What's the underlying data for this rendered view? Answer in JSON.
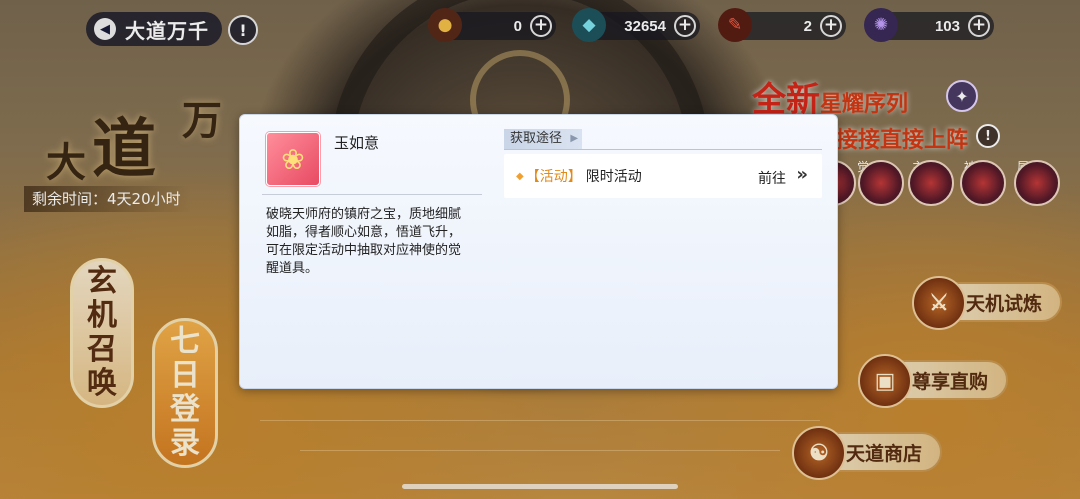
{
  "header": {
    "back_title": "大道万千",
    "info_glyph": "!",
    "resources": [
      {
        "icon": "coin-icon",
        "value": "0",
        "color": "#e0503c"
      },
      {
        "icon": "jade-icon",
        "value": "32654",
        "color": "#3fb6c8"
      },
      {
        "icon": "ticket-icon",
        "value": "2",
        "color": "#e04a2a"
      },
      {
        "icon": "orb-icon",
        "value": "103",
        "color": "#9a6ad8"
      }
    ],
    "plus_glyph": "+"
  },
  "banner": {
    "title_chars": [
      "大",
      "道",
      "万"
    ],
    "timer": "剩余时间：4天20小时",
    "xuanji": [
      "玄",
      "机",
      "召",
      "唤"
    ],
    "qiri": [
      "七",
      "日",
      "登",
      "录"
    ]
  },
  "promo": {
    "line1_big": "全新",
    "line1_small": "星耀序列",
    "line2": "接接直接上阵",
    "skill_tags": [
      "觉",
      "主",
      "被",
      "属"
    ]
  },
  "side_menu": [
    {
      "label": "天机试炼",
      "icon": "trial-icon",
      "glyph": "⚔"
    },
    {
      "label": "尊享直购",
      "icon": "chest-icon",
      "glyph": "▣"
    },
    {
      "label": "天道商店",
      "icon": "shop-icon",
      "glyph": "☯"
    }
  ],
  "modal": {
    "item_name": "玉如意",
    "item_description": "破晓天师府的镇府之宝，质地细腻\n如脂，得者顺心如意，悟道飞升，\n可在限定活动中抽取对应神使的觉\n醒道具。",
    "source_header": "获取途径",
    "sources": [
      {
        "type": "【活动】",
        "label": "限时活动",
        "action": "前往"
      }
    ]
  }
}
